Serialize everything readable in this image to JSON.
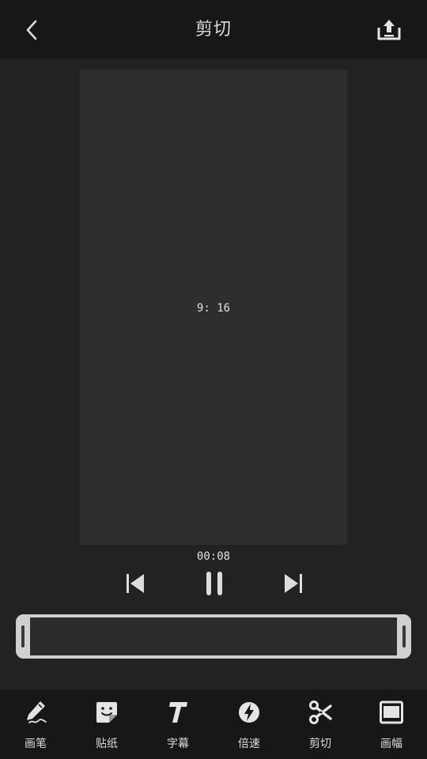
{
  "header": {
    "title": "剪切",
    "back_icon": "chevron-left-icon",
    "export_icon": "upload-tray-icon"
  },
  "preview": {
    "ratio_label": "9: 16"
  },
  "player": {
    "timecode": "00:08",
    "prev_icon": "skip-previous-icon",
    "pause_icon": "pause-icon",
    "next_icon": "skip-next-icon"
  },
  "toolbar": {
    "items": [
      {
        "label": "画笔",
        "icon": "pen-icon"
      },
      {
        "label": "贴纸",
        "icon": "sticker-icon"
      },
      {
        "label": "字幕",
        "icon": "text-icon"
      },
      {
        "label": "倍速",
        "icon": "speed-icon"
      },
      {
        "label": "剪切",
        "icon": "scissors-icon"
      },
      {
        "label": "画幅",
        "icon": "frame-icon"
      }
    ]
  },
  "colors": {
    "background": "#222222",
    "bars": "#171717",
    "preview": "#2e2e2e",
    "trim_frame": "#cfcfd4",
    "text": "#dcdcdc"
  }
}
